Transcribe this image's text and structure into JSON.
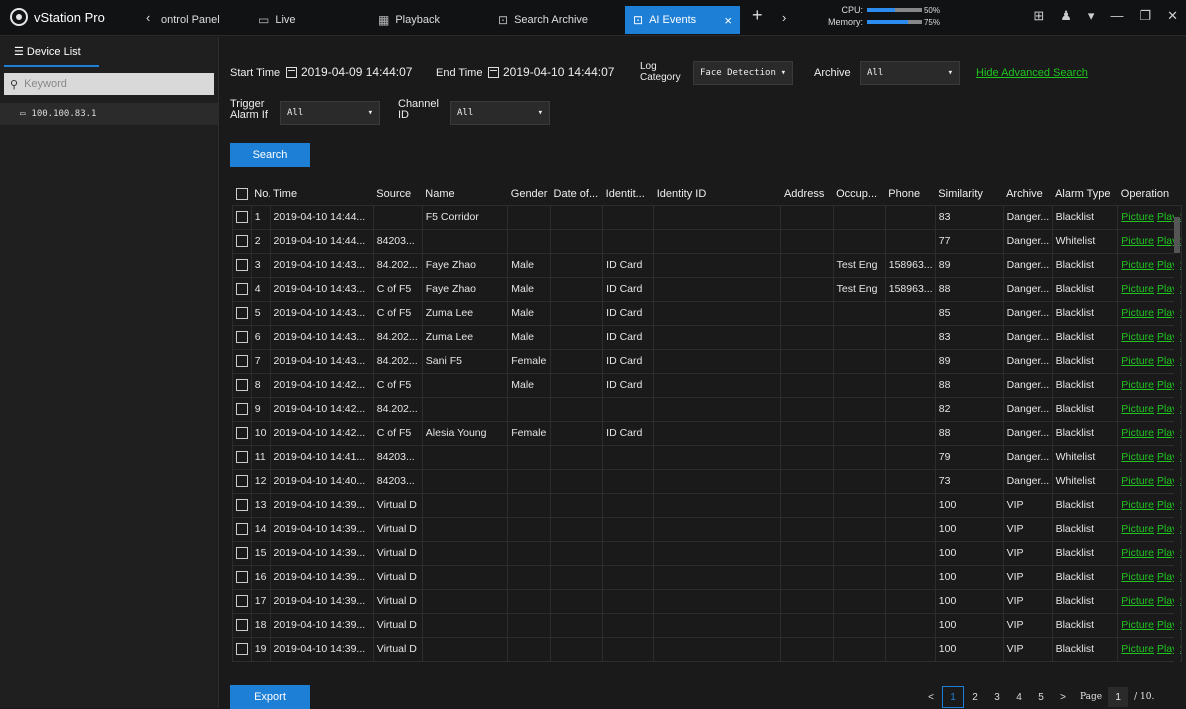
{
  "app": {
    "name": "vStation Pro"
  },
  "tabs": [
    {
      "label": "ontrol Panel",
      "icon": "chevron-left-icon"
    },
    {
      "label": "Live",
      "icon": "monitor-icon"
    },
    {
      "label": "Playback",
      "icon": "film-icon"
    },
    {
      "label": "Search Archive",
      "icon": "archive-search-icon"
    },
    {
      "label": "AI Events",
      "icon": "ai-icon",
      "active": true
    }
  ],
  "perf": {
    "cpu_label": "CPU:",
    "cpu_pct": "50%",
    "cpu_value": 0.5,
    "mem_label": "Memory:",
    "mem_pct": "75%",
    "mem_value": 0.75
  },
  "sidebar": {
    "title": "Device List",
    "keyword_placeholder": "Keyword",
    "device": "100.100.83.1"
  },
  "filters": {
    "start_label": "Start Time",
    "start_value": "2019-04-09 14:44:07",
    "end_label": "End Time",
    "end_value": "2019-04-10 14:44:07",
    "log_label_1": "Log",
    "log_label_2": "Category",
    "log_value": "Face Detection",
    "archive_label": "Archive",
    "archive_value": "All",
    "hide_adv": "Hide Advanced Search",
    "trigger_label_1": "Trigger",
    "trigger_label_2": "Alarm If",
    "trigger_value": "All",
    "channel_label_1": "Channel",
    "channel_label_2": "ID",
    "channel_value": "All",
    "search_button": "Search"
  },
  "table": {
    "headers": [
      "No.",
      "Time",
      "Source",
      "Name",
      "Gender",
      "Date of...",
      "Identit...",
      "Identity ID",
      "Address",
      "Occup...",
      "Phone",
      "Similarity",
      "Archive",
      "Alarm Type",
      "Operation"
    ],
    "op_picture": "Picture",
    "op_playback": "Playb.",
    "rows": [
      [
        "1",
        "2019-04-10 14:44...",
        "",
        "F5 Corridor",
        "",
        "",
        "",
        "",
        "",
        "",
        "",
        "83",
        "Danger...",
        "Blacklist"
      ],
      [
        "2",
        "2019-04-10 14:44...",
        "84203...",
        "",
        "",
        "",
        "",
        "",
        "",
        "",
        "",
        "77",
        "Danger...",
        "Whitelist"
      ],
      [
        "3",
        "2019-04-10 14:43...",
        "84.202...",
        "Faye Zhao",
        "Male",
        "",
        "ID Card",
        "",
        "",
        "Test Eng",
        "158963...",
        "89",
        "Danger...",
        "Blacklist"
      ],
      [
        "4",
        "2019-04-10 14:43...",
        "C of F5",
        "Faye Zhao",
        "Male",
        "",
        "ID Card",
        "",
        "",
        "Test Eng",
        "158963...",
        "88",
        "Danger...",
        "Blacklist"
      ],
      [
        "5",
        "2019-04-10 14:43...",
        "C of F5",
        "Zuma Lee",
        "Male",
        "",
        "ID Card",
        "",
        "",
        "",
        "",
        "85",
        "Danger...",
        "Blacklist"
      ],
      [
        "6",
        "2019-04-10 14:43...",
        "84.202...",
        "Zuma Lee",
        "Male",
        "",
        "ID Card",
        "",
        "",
        "",
        "",
        "83",
        "Danger...",
        "Blacklist"
      ],
      [
        "7",
        "2019-04-10 14:43...",
        "84.202...",
        "Sani F5",
        "Female",
        "",
        "ID Card",
        "",
        "",
        "",
        "",
        "89",
        "Danger...",
        "Blacklist"
      ],
      [
        "8",
        "2019-04-10 14:42...",
        "C of F5",
        "",
        "Male",
        "",
        "ID Card",
        "",
        "",
        "",
        "",
        "88",
        "Danger...",
        "Blacklist"
      ],
      [
        "9",
        "2019-04-10 14:42...",
        "84.202...",
        "",
        "",
        "",
        "",
        "",
        "",
        "",
        "",
        "82",
        "Danger...",
        "Blacklist"
      ],
      [
        "10",
        "2019-04-10 14:42...",
        "C of F5",
        "Alesia Young",
        "Female",
        "",
        "ID Card",
        "",
        "",
        "",
        "",
        "88",
        "Danger...",
        "Blacklist"
      ],
      [
        "11",
        "2019-04-10 14:41...",
        "84203...",
        "",
        "",
        "",
        "",
        "",
        "",
        "",
        "",
        "79",
        "Danger...",
        "Whitelist"
      ],
      [
        "12",
        "2019-04-10 14:40...",
        "84203...",
        "",
        "",
        "",
        "",
        "",
        "",
        "",
        "",
        "73",
        "Danger...",
        "Whitelist"
      ],
      [
        "13",
        "2019-04-10 14:39...",
        "Virtual D",
        "",
        "",
        "",
        "",
        "",
        "",
        "",
        "",
        "100",
        "VIP",
        "Blacklist"
      ],
      [
        "14",
        "2019-04-10 14:39...",
        "Virtual D",
        "",
        "",
        "",
        "",
        "",
        "",
        "",
        "",
        "100",
        "VIP",
        "Blacklist"
      ],
      [
        "15",
        "2019-04-10 14:39...",
        "Virtual D",
        "",
        "",
        "",
        "",
        "",
        "",
        "",
        "",
        "100",
        "VIP",
        "Blacklist"
      ],
      [
        "16",
        "2019-04-10 14:39...",
        "Virtual D",
        "",
        "",
        "",
        "",
        "",
        "",
        "",
        "",
        "100",
        "VIP",
        "Blacklist"
      ],
      [
        "17",
        "2019-04-10 14:39...",
        "Virtual D",
        "",
        "",
        "",
        "",
        "",
        "",
        "",
        "",
        "100",
        "VIP",
        "Blacklist"
      ],
      [
        "18",
        "2019-04-10 14:39...",
        "Virtual D",
        "",
        "",
        "",
        "",
        "",
        "",
        "",
        "",
        "100",
        "VIP",
        "Blacklist"
      ],
      [
        "19",
        "2019-04-10 14:39...",
        "Virtual D",
        "",
        "",
        "",
        "",
        "",
        "",
        "",
        "",
        "100",
        "VIP",
        "Blacklist"
      ]
    ]
  },
  "footer": {
    "export": "Export",
    "pages": [
      "1",
      "2",
      "3",
      "4",
      "5"
    ],
    "current_page": "1",
    "page_label": "Page",
    "page_input": "1",
    "page_total": "/ 10."
  }
}
